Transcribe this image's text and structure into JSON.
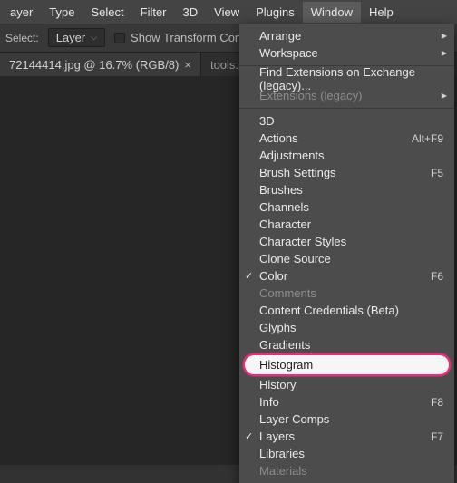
{
  "menubar": {
    "items": [
      "ayer",
      "Type",
      "Select",
      "Filter",
      "3D",
      "View",
      "Plugins",
      "Window",
      "Help"
    ],
    "active": "Window"
  },
  "options": {
    "select_label": "Select:",
    "select_value": "Layer",
    "show_transform_label": "Show Transform Controls"
  },
  "tabs": [
    {
      "label": "72144414.jpg @ 16.7% (RGB/8)",
      "active": true
    },
    {
      "label": "tools.psd @",
      "active": false
    }
  ],
  "menu": {
    "groups": [
      [
        {
          "label": "Arrange",
          "submenu": true
        },
        {
          "label": "Workspace",
          "submenu": true
        }
      ],
      [
        {
          "label": "Find Extensions on Exchange (legacy)..."
        },
        {
          "label": "Extensions (legacy)",
          "submenu": true,
          "disabled": true
        }
      ],
      [
        {
          "label": "3D"
        },
        {
          "label": "Actions",
          "shortcut": "Alt+F9"
        },
        {
          "label": "Adjustments"
        },
        {
          "label": "Brush Settings",
          "shortcut": "F5"
        },
        {
          "label": "Brushes"
        },
        {
          "label": "Channels"
        },
        {
          "label": "Character"
        },
        {
          "label": "Character Styles"
        },
        {
          "label": "Clone Source"
        },
        {
          "label": "Color",
          "shortcut": "F6",
          "checked": true
        },
        {
          "label": "Comments",
          "disabled": true
        },
        {
          "label": "Content Credentials (Beta)"
        },
        {
          "label": "Glyphs"
        },
        {
          "label": "Gradients"
        },
        {
          "label": "Histogram",
          "highlight": true
        },
        {
          "label": "History"
        },
        {
          "label": "Info",
          "shortcut": "F8"
        },
        {
          "label": "Layer Comps"
        },
        {
          "label": "Layers",
          "shortcut": "F7",
          "checked": true
        },
        {
          "label": "Libraries"
        },
        {
          "label": "Materials",
          "disabled": true
        }
      ]
    ]
  }
}
